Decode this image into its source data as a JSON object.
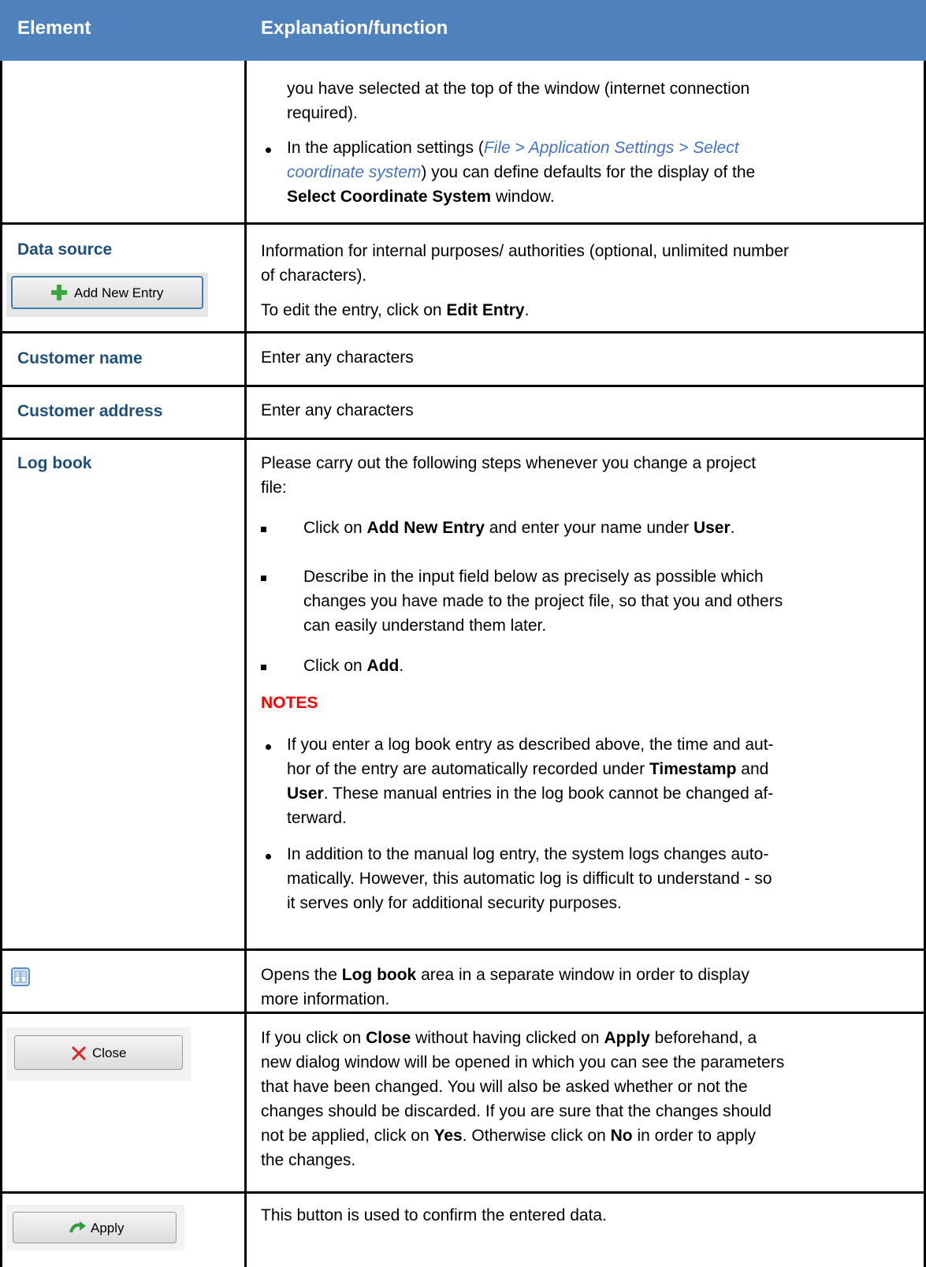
{
  "header": {
    "col_element": "Element",
    "col_explanation": "Explanation/function"
  },
  "rows": {
    "coordsys": {
      "line1": "you have selected at the top of the window (internet connection",
      "line2": "required).",
      "bullet_pre": "In the application settings (",
      "bullet_link": "File > Application Settings > Select",
      "bullet_link2": "coordinate system",
      "bullet_post": ") you can define defaults for the display of the",
      "bullet_bold": "Select Coordinate System",
      "bullet_end": "window."
    },
    "datasource": {
      "label": "Data source",
      "button_label": "Add New Entry",
      "text1": "Information for internal purposes/ authorities (optional, unlimited number",
      "text2": "of characters).",
      "text3_pre": "To edit the entry, click on",
      "text3_bold": "Edit Entry",
      "text3_end": "."
    },
    "customer_name": {
      "label": "Customer name",
      "text": "Enter any characters"
    },
    "customer_address": {
      "label": "Customer address",
      "text": "Enter any characters"
    },
    "logbook": {
      "label": "Log book",
      "intro1": "Please carry out the following steps whenever you change a project",
      "intro2": "file:",
      "step1_pre": "Click on",
      "step1_b1": "Add New Entry",
      "step1_mid": "and enter your name under",
      "step1_b2": "User",
      "step1_end": ".",
      "step2_l1": "Describe in the input field below as precisely as possible which",
      "step2_l2": "changes you have made to the project file, so that you and others",
      "step2_l3": "can easily understand them later.",
      "step3_pre": "Click on",
      "step3_b": "Add",
      "step3_end": ".",
      "notes_title": "NOTES",
      "note1_l1": "If you enter a log book entry as described above, the time and aut-",
      "note1_l2_pre": "hor of the entry are automatically recorded under",
      "note1_l2_b": "Timestamp",
      "note1_l2_end": "and",
      "note1_l3_b": "User",
      "note1_l3_end": ". These manual entries in the log book cannot be changed af-",
      "note1_l4": "terward.",
      "note2_l1": "In addition to the manual log entry, the system logs changes auto-",
      "note2_l2": "matically. However, this automatic log is difficult to understand - so",
      "note2_l3": "it serves only for additional security purposes."
    },
    "logbook_icon": {
      "pre": "Opens the",
      "bold": "Log book",
      "post": "area in a separate window in order to display",
      "line2": "more information."
    },
    "close": {
      "button_label": "Close",
      "l1_pre": "If you click on",
      "l1_b1": "Close",
      "l1_mid": "without having clicked on",
      "l1_b2": "Apply",
      "l1_end": "beforehand, a",
      "l2": "new dialog window will be opened in which you can see the parameters",
      "l3": "that have been changed. You will also be asked whether or not the",
      "l4": "changes should be discarded. If you are sure that the changes should",
      "l5_pre": "not be applied, click on",
      "l5_b": "Yes",
      "l5_mid": ". Otherwise click on",
      "l5_b2": "No",
      "l5_end": "in order to apply",
      "l6": "the changes."
    },
    "apply": {
      "button_label": "Apply",
      "text": "This button is used to confirm the entered data."
    }
  },
  "colors": {
    "header_bg": "#4f81bd",
    "label": "#1f4e79",
    "link": "#4472c4",
    "notes": "#ff0000"
  }
}
